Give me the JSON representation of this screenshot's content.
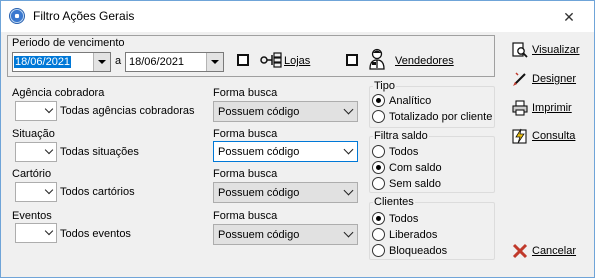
{
  "window": {
    "title": "Filtro Ações Gerais",
    "close_symbol": "✕"
  },
  "period": {
    "label": "Periodo de vencimento",
    "date_from": "18/06/2021",
    "separator": "a",
    "date_to": "18/06/2021",
    "lojas_label": "Lojas",
    "vendedores_label": "Vendedores"
  },
  "filters": [
    {
      "label": "Agência cobradora",
      "value_text": "Todas agências cobradoras",
      "busca_label": "Forma busca",
      "busca_value": "Possuem código"
    },
    {
      "label": "Situação",
      "value_text": "Todas situações",
      "busca_label": "Forma busca",
      "busca_value": "Possuem código"
    },
    {
      "label": "Cartório",
      "value_text": "Todos cartórios",
      "busca_label": "Forma busca",
      "busca_value": "Possuem código"
    },
    {
      "label": "Eventos",
      "value_text": "Todos eventos",
      "busca_label": "Forma busca",
      "busca_value": "Possuem código"
    }
  ],
  "tipo": {
    "title": "Tipo",
    "options": [
      "Analítico",
      "Totalizado por cliente"
    ],
    "selected": 0
  },
  "saldo": {
    "title": "Filtra saldo",
    "options": [
      "Todos",
      "Com saldo",
      "Sem saldo"
    ],
    "selected": 1
  },
  "clientes": {
    "title": "Clientes",
    "options": [
      "Todos",
      "Liberados",
      "Bloqueados"
    ],
    "selected": 0
  },
  "actions": {
    "visualizar": "Visualizar",
    "designer": "Designer",
    "imprimir": "Imprimir",
    "consulta": "Consulta",
    "cancelar": "Cancelar"
  },
  "colors": {
    "accent": "#0078d7",
    "window_border": "#6fa4d8",
    "cancel_red": "#c0392b"
  }
}
